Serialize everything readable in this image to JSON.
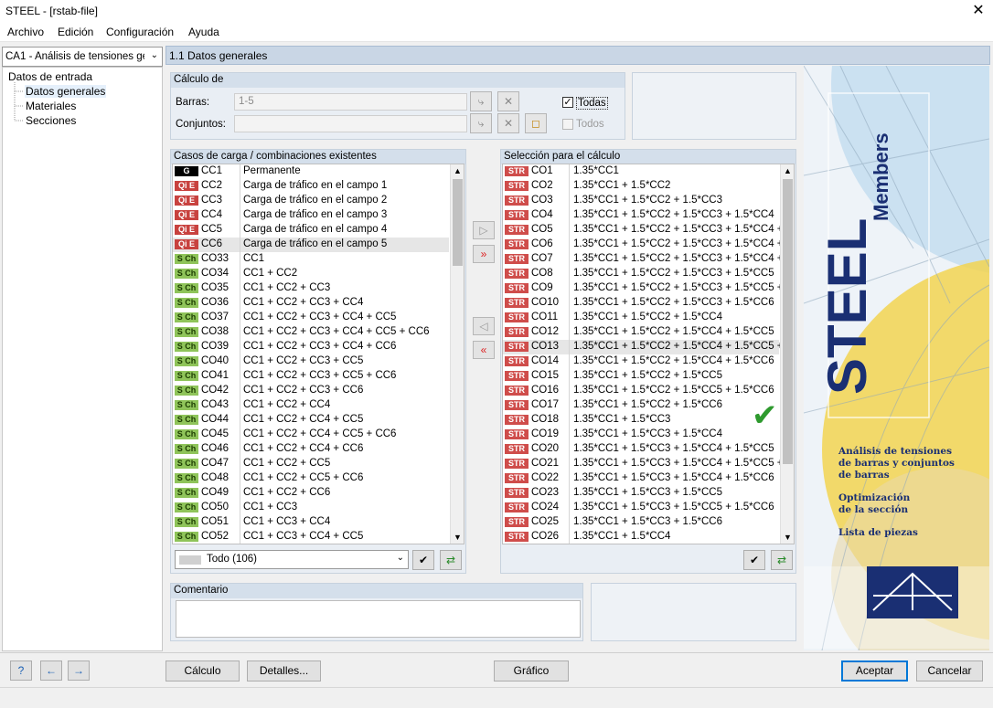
{
  "window": {
    "title": "STEEL - [rstab-file]",
    "close_glyph": "✕"
  },
  "menu": [
    "Archivo",
    "Edición",
    "Configuración",
    "Ayuda"
  ],
  "navigator": {
    "case_combo": "CA1 - Análisis de tensiones gen",
    "tree_root": "Datos de entrada",
    "tree_items": [
      "Datos generales",
      "Materiales",
      "Secciones"
    ]
  },
  "page_title": "1.1 Datos generales",
  "calc": {
    "title": "Cálculo de",
    "members_label": "Barras:",
    "members_value": "1-5",
    "sets_label": "Conjuntos:",
    "sets_value": "",
    "all_members_label": "Todas",
    "all_sets_label": "Todos"
  },
  "existing": {
    "title": "Casos de carga / combinaciones existentes",
    "filter": "Todo (106)",
    "rows": [
      {
        "badge": "G",
        "type": "G",
        "name": "CC1",
        "desc": "Permanente"
      },
      {
        "badge": "Qi E",
        "type": "QiE",
        "name": "CC2",
        "desc": "Carga de tráfico en el campo 1"
      },
      {
        "badge": "Qi E",
        "type": "QiE",
        "name": "CC3",
        "desc": "Carga de tráfico en el campo 2"
      },
      {
        "badge": "Qi E",
        "type": "QiE",
        "name": "CC4",
        "desc": "Carga de tráfico en el campo 3"
      },
      {
        "badge": "Qi E",
        "type": "QiE",
        "name": "CC5",
        "desc": "Carga de tráfico en el campo 4"
      },
      {
        "badge": "Qi E",
        "type": "QiE",
        "name": "CC6",
        "desc": "Carga de tráfico en el campo 5"
      },
      {
        "badge": "S Ch",
        "type": "SCh",
        "name": "CO33",
        "desc": "CC1"
      },
      {
        "badge": "S Ch",
        "type": "SCh",
        "name": "CO34",
        "desc": "CC1 + CC2"
      },
      {
        "badge": "S Ch",
        "type": "SCh",
        "name": "CO35",
        "desc": "CC1 + CC2 + CC3"
      },
      {
        "badge": "S Ch",
        "type": "SCh",
        "name": "CO36",
        "desc": "CC1 + CC2 + CC3 + CC4"
      },
      {
        "badge": "S Ch",
        "type": "SCh",
        "name": "CO37",
        "desc": "CC1 + CC2 + CC3 + CC4 + CC5"
      },
      {
        "badge": "S Ch",
        "type": "SCh",
        "name": "CO38",
        "desc": "CC1 + CC2 + CC3 + CC4 + CC5 + CC6"
      },
      {
        "badge": "S Ch",
        "type": "SCh",
        "name": "CO39",
        "desc": "CC1 + CC2 + CC3 + CC4 + CC6"
      },
      {
        "badge": "S Ch",
        "type": "SCh",
        "name": "CO40",
        "desc": "CC1 + CC2 + CC3 + CC5"
      },
      {
        "badge": "S Ch",
        "type": "SCh",
        "name": "CO41",
        "desc": "CC1 + CC2 + CC3 + CC5 + CC6"
      },
      {
        "badge": "S Ch",
        "type": "SCh",
        "name": "CO42",
        "desc": "CC1 + CC2 + CC3 + CC6"
      },
      {
        "badge": "S Ch",
        "type": "SCh",
        "name": "CO43",
        "desc": "CC1 + CC2 + CC4"
      },
      {
        "badge": "S Ch",
        "type": "SCh",
        "name": "CO44",
        "desc": "CC1 + CC2 + CC4 + CC5"
      },
      {
        "badge": "S Ch",
        "type": "SCh",
        "name": "CO45",
        "desc": "CC1 + CC2 + CC4 + CC5 + CC6"
      },
      {
        "badge": "S Ch",
        "type": "SCh",
        "name": "CO46",
        "desc": "CC1 + CC2 + CC4 + CC6"
      },
      {
        "badge": "S Ch",
        "type": "SCh",
        "name": "CO47",
        "desc": "CC1 + CC2 + CC5"
      },
      {
        "badge": "S Ch",
        "type": "SCh",
        "name": "CO48",
        "desc": "CC1 + CC2 + CC5 + CC6"
      },
      {
        "badge": "S Ch",
        "type": "SCh",
        "name": "CO49",
        "desc": "CC1 + CC2 + CC6"
      },
      {
        "badge": "S Ch",
        "type": "SCh",
        "name": "CO50",
        "desc": "CC1 + CC3"
      },
      {
        "badge": "S Ch",
        "type": "SCh",
        "name": "CO51",
        "desc": "CC1 + CC3 + CC4"
      },
      {
        "badge": "S Ch",
        "type": "SCh",
        "name": "CO52",
        "desc": "CC1 + CC3 + CC4 + CC5"
      }
    ]
  },
  "selected": {
    "title": "Selección para el cálculo",
    "rows": [
      {
        "badge": "STR",
        "name": "CO1",
        "desc": "1.35*CC1"
      },
      {
        "badge": "STR",
        "name": "CO2",
        "desc": "1.35*CC1 + 1.5*CC2"
      },
      {
        "badge": "STR",
        "name": "CO3",
        "desc": "1.35*CC1 + 1.5*CC2 + 1.5*CC3"
      },
      {
        "badge": "STR",
        "name": "CO4",
        "desc": "1.35*CC1 + 1.5*CC2 + 1.5*CC3 + 1.5*CC4"
      },
      {
        "badge": "STR",
        "name": "CO5",
        "desc": "1.35*CC1 + 1.5*CC2 + 1.5*CC3 + 1.5*CC4 + 1."
      },
      {
        "badge": "STR",
        "name": "CO6",
        "desc": "1.35*CC1 + 1.5*CC2 + 1.5*CC3 + 1.5*CC4 + 1."
      },
      {
        "badge": "STR",
        "name": "CO7",
        "desc": "1.35*CC1 + 1.5*CC2 + 1.5*CC3 + 1.5*CC4 + 1."
      },
      {
        "badge": "STR",
        "name": "CO8",
        "desc": "1.35*CC1 + 1.5*CC2 + 1.5*CC3 + 1.5*CC5"
      },
      {
        "badge": "STR",
        "name": "CO9",
        "desc": "1.35*CC1 + 1.5*CC2 + 1.5*CC3 + 1.5*CC5 + 1."
      },
      {
        "badge": "STR",
        "name": "CO10",
        "desc": "1.35*CC1 + 1.5*CC2 + 1.5*CC3 + 1.5*CC6"
      },
      {
        "badge": "STR",
        "name": "CO11",
        "desc": "1.35*CC1 + 1.5*CC2 + 1.5*CC4"
      },
      {
        "badge": "STR",
        "name": "CO12",
        "desc": "1.35*CC1 + 1.5*CC2 + 1.5*CC4 + 1.5*CC5"
      },
      {
        "badge": "STR",
        "name": "CO13",
        "desc": "1.35*CC1 + 1.5*CC2 + 1.5*CC4 + 1.5*CC5 + 1."
      },
      {
        "badge": "STR",
        "name": "CO14",
        "desc": "1.35*CC1 + 1.5*CC2 + 1.5*CC4 + 1.5*CC6"
      },
      {
        "badge": "STR",
        "name": "CO15",
        "desc": "1.35*CC1 + 1.5*CC2 + 1.5*CC5"
      },
      {
        "badge": "STR",
        "name": "CO16",
        "desc": "1.35*CC1 + 1.5*CC2 + 1.5*CC5 + 1.5*CC6"
      },
      {
        "badge": "STR",
        "name": "CO17",
        "desc": "1.35*CC1 + 1.5*CC2 + 1.5*CC6"
      },
      {
        "badge": "STR",
        "name": "CO18",
        "desc": "1.35*CC1 + 1.5*CC3"
      },
      {
        "badge": "STR",
        "name": "CO19",
        "desc": "1.35*CC1 + 1.5*CC3 + 1.5*CC4"
      },
      {
        "badge": "STR",
        "name": "CO20",
        "desc": "1.35*CC1 + 1.5*CC3 + 1.5*CC4 + 1.5*CC5"
      },
      {
        "badge": "STR",
        "name": "CO21",
        "desc": "1.35*CC1 + 1.5*CC3 + 1.5*CC4 + 1.5*CC5 + 1."
      },
      {
        "badge": "STR",
        "name": "CO22",
        "desc": "1.35*CC1 + 1.5*CC3 + 1.5*CC4 + 1.5*CC6"
      },
      {
        "badge": "STR",
        "name": "CO23",
        "desc": "1.35*CC1 + 1.5*CC3 + 1.5*CC5"
      },
      {
        "badge": "STR",
        "name": "CO24",
        "desc": "1.35*CC1 + 1.5*CC3 + 1.5*CC5 + 1.5*CC6"
      },
      {
        "badge": "STR",
        "name": "CO25",
        "desc": "1.35*CC1 + 1.5*CC3 + 1.5*CC6"
      },
      {
        "badge": "STR",
        "name": "CO26",
        "desc": "1.35*CC1 + 1.5*CC4"
      }
    ]
  },
  "comment": {
    "title": "Comentario",
    "value": ""
  },
  "banner": {
    "brand": "STEEL",
    "product": "Members",
    "features": [
      "Análisis de tensiones",
      "de barras y conjuntos",
      "de barras",
      "Optimización",
      "de la sección",
      "Lista de piezas"
    ]
  },
  "footer": {
    "calc": "Cálculo",
    "details": "Detalles...",
    "graphic": "Gráfico",
    "accept": "Aceptar",
    "cancel": "Cancelar"
  },
  "colors": {
    "accent": "#c9d6e5",
    "str_badge": "#cf4d4b",
    "sch_badge": "#8fc45a",
    "brand_navy": "#1a2f73",
    "checkmark": "#2e9a2e"
  }
}
